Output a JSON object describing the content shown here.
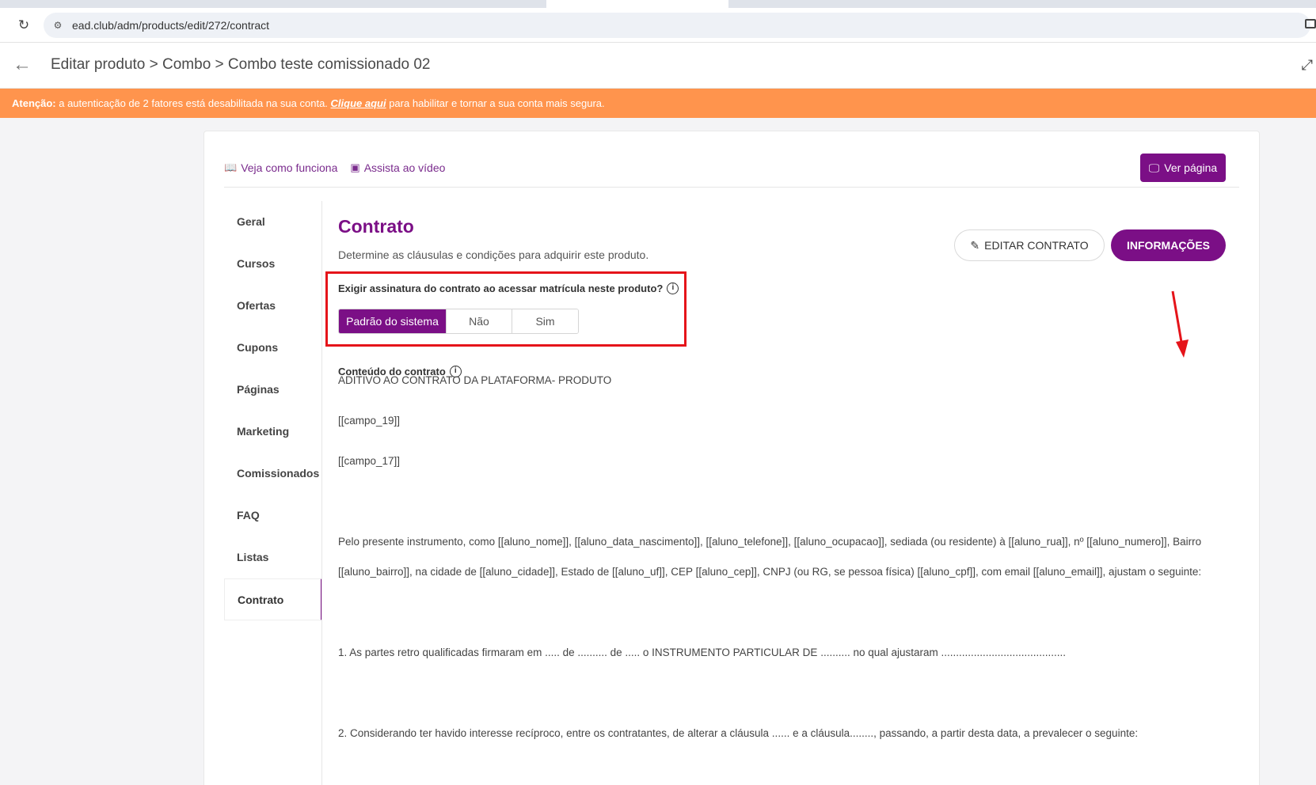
{
  "browser": {
    "url": "ead.club/adm/products/edit/272/contract"
  },
  "header": {
    "breadcrumb": "Editar produto > Combo > Combo teste comissionado 02"
  },
  "warning": {
    "prefix": "Atenção:",
    "text": " a autenticação de 2 fatores está desabilitada na sua conta. ",
    "link": "Clique aqui",
    "suffix": " para habilitar e tornar a sua conta mais segura."
  },
  "toplinks": {
    "how_it_works": "Veja como funciona",
    "watch_video": "Assista ao vídeo",
    "view_page": "Ver página"
  },
  "sidebar": {
    "items": [
      {
        "label": "Geral"
      },
      {
        "label": "Cursos"
      },
      {
        "label": "Ofertas"
      },
      {
        "label": "Cupons"
      },
      {
        "label": "Páginas"
      },
      {
        "label": "Marketing"
      },
      {
        "label": "Comissionados"
      },
      {
        "label": "FAQ"
      },
      {
        "label": "Listas"
      },
      {
        "label": "Contrato"
      }
    ],
    "active": "Contrato"
  },
  "main": {
    "title": "Contrato",
    "subtitle": "Determine as cláusulas e condições para adquirir este produto.",
    "edit_button": "EDITAR CONTRATO",
    "info_button": "INFORMAÇÕES",
    "question": "Exigir assinatura do contrato ao acessar matrícula neste produto?",
    "options": [
      "Padrão do sistema",
      "Não",
      "Sim"
    ],
    "selected_option": "Padrão do sistema",
    "content_label": "Conteúdo do contrato",
    "contract_lines": [
      "ADITIVO AO CONTRATO DA PLATAFORMA- PRODUTO",
      "[[campo_19]]",
      "[[campo_17]]",
      "Pelo presente instrumento, como [[aluno_nome]], [[aluno_data_nascimento]], [[aluno_telefone]], [[aluno_ocupacao]], sediada (ou residente) à [[aluno_rua]], nº [[aluno_numero]], Bairro",
      "[[aluno_bairro]], na cidade de [[aluno_cidade]], Estado de [[aluno_uf]], CEP [[aluno_cep]], CNPJ (ou RG, se pessoa física) [[aluno_cpf]], com email [[aluno_email]], ajustam o seguinte:",
      "1. As partes retro qualificadas firmaram em ..... de .......... de ..... o INSTRUMENTO PARTICULAR DE .......... no qual ajustaram ..........................................",
      "2. Considerando ter havido interesse recíproco, entre os contratantes, de alterar a cláusula ...... e a cláusula........, passando, a partir desta data, a prevalecer o seguinte:"
    ]
  },
  "colors": {
    "brand": "#7b0f86",
    "warning": "#ff944d",
    "annotation": "#e5141a"
  }
}
